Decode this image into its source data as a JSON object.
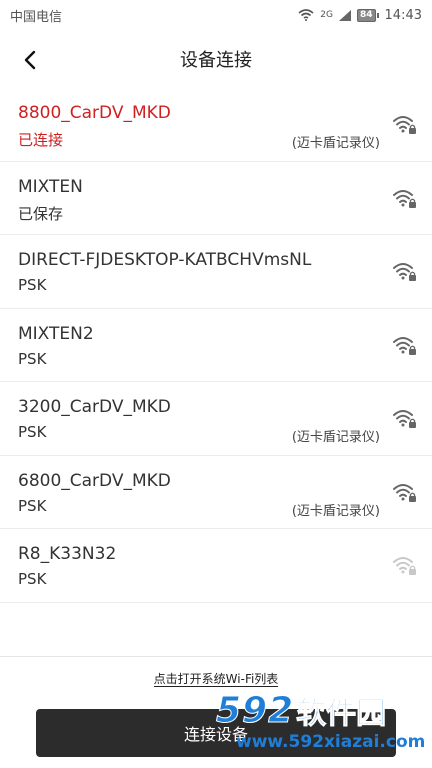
{
  "status_bar": {
    "carrier": "中国电信",
    "network": "2G",
    "battery": "84",
    "time": "14:43"
  },
  "header": {
    "title": "设备连接"
  },
  "networks": [
    {
      "ssid": "8800_CarDV_MKD",
      "sub": "已连接",
      "tag": "(迈卡盾记录仪)",
      "connected": true,
      "strength": "strong"
    },
    {
      "ssid": "MIXTEN",
      "sub": "已保存",
      "tag": "",
      "connected": false,
      "strength": "strong"
    },
    {
      "ssid": "DIRECT-FJDESKTOP-KATBCHVmsNL",
      "sub": "PSK",
      "tag": "",
      "connected": false,
      "strength": "strong"
    },
    {
      "ssid": "MIXTEN2",
      "sub": "PSK",
      "tag": "",
      "connected": false,
      "strength": "strong"
    },
    {
      "ssid": "3200_CarDV_MKD",
      "sub": "PSK",
      "tag": "(迈卡盾记录仪)",
      "connected": false,
      "strength": "strong"
    },
    {
      "ssid": "6800_CarDV_MKD",
      "sub": "PSK",
      "tag": "(迈卡盾记录仪)",
      "connected": false,
      "strength": "strong"
    },
    {
      "ssid": "R8_K33N32",
      "sub": "PSK",
      "tag": "",
      "connected": false,
      "strength": "weak"
    }
  ],
  "footer": {
    "open_wifi_link": "点击打开系统Wi-Fi列表",
    "connect_button": "连接设备"
  },
  "watermark": {
    "number": "592",
    "name": "软件园",
    "url": "www.592xiazai.com"
  },
  "colors": {
    "connected": "#d02121",
    "button_bg": "#2c2c2c",
    "watermark": "#1f7fd8"
  }
}
